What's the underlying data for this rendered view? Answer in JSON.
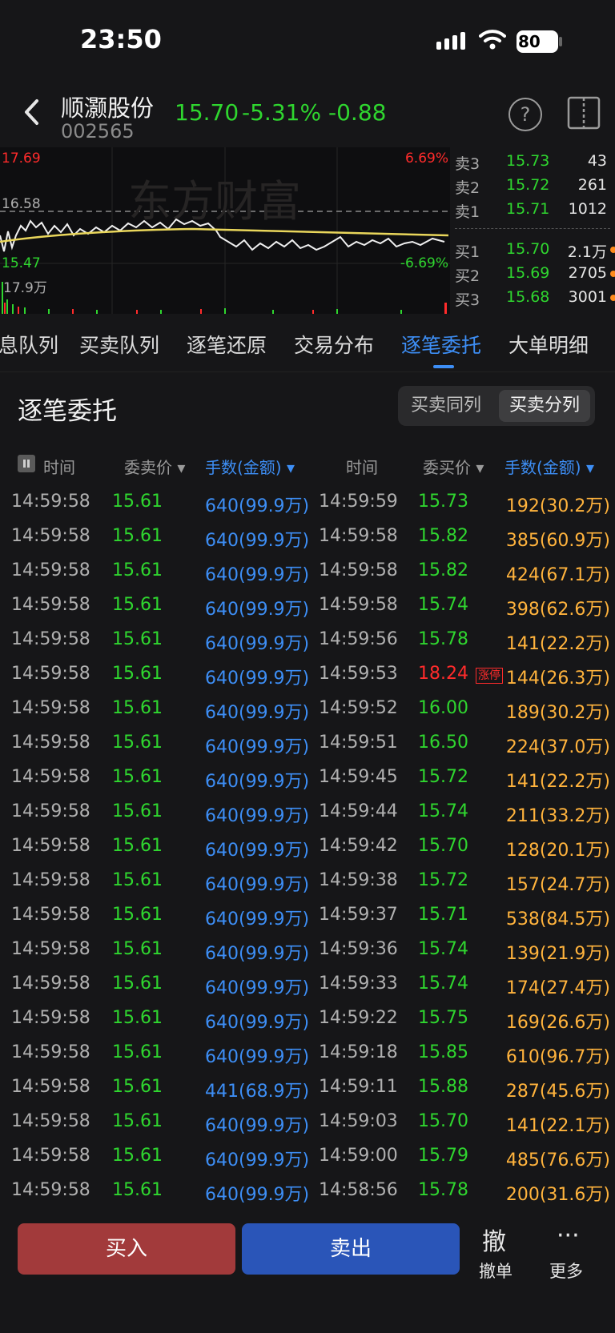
{
  "status_bar": {
    "time": "23:50",
    "battery": "80"
  },
  "header": {
    "stock_name": "顺灏股份",
    "stock_code": "002565",
    "price": "15.70",
    "change_pct": "-5.31%",
    "change": "-0.88",
    "help_glyph": "?"
  },
  "chart": {
    "high_label": "17.69",
    "ref_label": "16.58",
    "low_label": "15.47",
    "up_pct_label": "6.69%",
    "down_pct_label": "-6.69%",
    "volume_label": "17.9万",
    "watermark": "东方财富"
  },
  "orderbook": {
    "asks": [
      {
        "side": "卖3",
        "price": "15.73",
        "vol": "43"
      },
      {
        "side": "卖2",
        "price": "15.72",
        "vol": "261"
      },
      {
        "side": "卖1",
        "price": "15.71",
        "vol": "1012"
      }
    ],
    "bids": [
      {
        "side": "买1",
        "price": "15.70",
        "vol": "2.1万"
      },
      {
        "side": "买2",
        "price": "15.69",
        "vol": "2705"
      },
      {
        "side": "买3",
        "price": "15.68",
        "vol": "3001"
      }
    ]
  },
  "tabs": [
    "息队列",
    "买卖队列",
    "逐笔还原",
    "交易分布",
    "逐笔委托",
    "大单明细"
  ],
  "section": {
    "title": "逐笔委托",
    "toggle_same": "买卖同列",
    "toggle_split": "买卖分列"
  },
  "columns": {
    "time": "时间",
    "sell_price": "委卖价",
    "sell_vol": "手数(金额)",
    "time2": "时间",
    "buy_price": "委买价",
    "buy_vol": "手数(金额)"
  },
  "limit_badge": "涨停",
  "rows": [
    {
      "t1": "14:59:58",
      "p1": "15.61",
      "v1": "640(99.9万)",
      "t2": "14:59:59",
      "p2": "15.73",
      "v2": "192(30.2万)"
    },
    {
      "t1": "14:59:58",
      "p1": "15.61",
      "v1": "640(99.9万)",
      "t2": "14:59:58",
      "p2": "15.82",
      "v2": "385(60.9万)"
    },
    {
      "t1": "14:59:58",
      "p1": "15.61",
      "v1": "640(99.9万)",
      "t2": "14:59:58",
      "p2": "15.82",
      "v2": "424(67.1万)"
    },
    {
      "t1": "14:59:58",
      "p1": "15.61",
      "v1": "640(99.9万)",
      "t2": "14:59:58",
      "p2": "15.74",
      "v2": "398(62.6万)"
    },
    {
      "t1": "14:59:58",
      "p1": "15.61",
      "v1": "640(99.9万)",
      "t2": "14:59:56",
      "p2": "15.78",
      "v2": "141(22.2万)"
    },
    {
      "t1": "14:59:58",
      "p1": "15.61",
      "v1": "640(99.9万)",
      "t2": "14:59:53",
      "p2": "18.24",
      "v2": "144(26.3万)",
      "limit": true
    },
    {
      "t1": "14:59:58",
      "p1": "15.61",
      "v1": "640(99.9万)",
      "t2": "14:59:52",
      "p2": "16.00",
      "v2": "189(30.2万)"
    },
    {
      "t1": "14:59:58",
      "p1": "15.61",
      "v1": "640(99.9万)",
      "t2": "14:59:51",
      "p2": "16.50",
      "v2": "224(37.0万)"
    },
    {
      "t1": "14:59:58",
      "p1": "15.61",
      "v1": "640(99.9万)",
      "t2": "14:59:45",
      "p2": "15.72",
      "v2": "141(22.2万)"
    },
    {
      "t1": "14:59:58",
      "p1": "15.61",
      "v1": "640(99.9万)",
      "t2": "14:59:44",
      "p2": "15.74",
      "v2": "211(33.2万)"
    },
    {
      "t1": "14:59:58",
      "p1": "15.61",
      "v1": "640(99.9万)",
      "t2": "14:59:42",
      "p2": "15.70",
      "v2": "128(20.1万)"
    },
    {
      "t1": "14:59:58",
      "p1": "15.61",
      "v1": "640(99.9万)",
      "t2": "14:59:38",
      "p2": "15.72",
      "v2": "157(24.7万)"
    },
    {
      "t1": "14:59:58",
      "p1": "15.61",
      "v1": "640(99.9万)",
      "t2": "14:59:37",
      "p2": "15.71",
      "v2": "538(84.5万)"
    },
    {
      "t1": "14:59:58",
      "p1": "15.61",
      "v1": "640(99.9万)",
      "t2": "14:59:36",
      "p2": "15.74",
      "v2": "139(21.9万)"
    },
    {
      "t1": "14:59:58",
      "p1": "15.61",
      "v1": "640(99.9万)",
      "t2": "14:59:33",
      "p2": "15.74",
      "v2": "174(27.4万)"
    },
    {
      "t1": "14:59:58",
      "p1": "15.61",
      "v1": "640(99.9万)",
      "t2": "14:59:22",
      "p2": "15.75",
      "v2": "169(26.6万)"
    },
    {
      "t1": "14:59:58",
      "p1": "15.61",
      "v1": "640(99.9万)",
      "t2": "14:59:18",
      "p2": "15.85",
      "v2": "610(96.7万)"
    },
    {
      "t1": "14:59:58",
      "p1": "15.61",
      "v1": "441(68.9万)",
      "t2": "14:59:11",
      "p2": "15.88",
      "v2": "287(45.6万)"
    },
    {
      "t1": "14:59:58",
      "p1": "15.61",
      "v1": "640(99.9万)",
      "t2": "14:59:03",
      "p2": "15.70",
      "v2": "141(22.1万)"
    },
    {
      "t1": "14:59:58",
      "p1": "15.61",
      "v1": "640(99.9万)",
      "t2": "14:59:00",
      "p2": "15.79",
      "v2": "485(76.6万)"
    },
    {
      "t1": "14:59:58",
      "p1": "15.61",
      "v1": "640(99.9万)",
      "t2": "14:58:56",
      "p2": "15.78",
      "v2": "200(31.6万)"
    }
  ],
  "bottom": {
    "buy": "买入",
    "sell": "卖出",
    "cancel_icon": "撤",
    "cancel": "撤单",
    "more_icon": "···",
    "more": "更多"
  },
  "colors": {
    "up": "#ff2b2b",
    "down": "#2fd62f",
    "accent": "#3d8ef5",
    "buy_vol": "#ffb33d"
  }
}
